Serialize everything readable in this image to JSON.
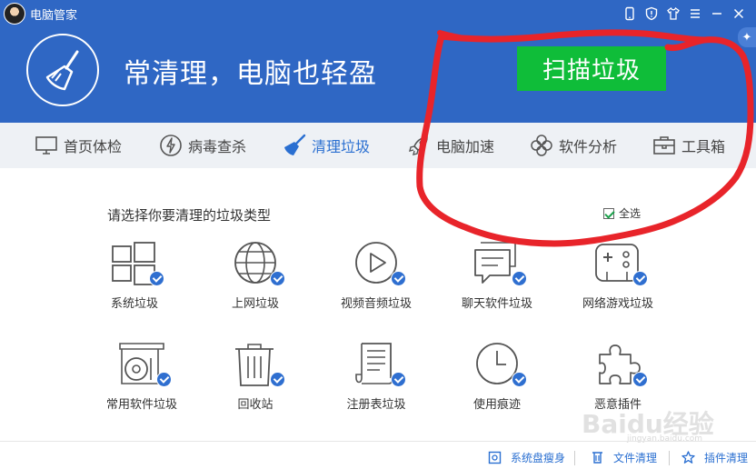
{
  "app": {
    "title": "电脑管家"
  },
  "header": {
    "slogan": "常清理，电脑也轻盈",
    "scan_label": "扫描垃圾"
  },
  "nav": {
    "items": [
      {
        "label": "首页体检",
        "icon": "monitor-icon"
      },
      {
        "label": "病毒查杀",
        "icon": "lightning-icon"
      },
      {
        "label": "清理垃圾",
        "icon": "broom-icon",
        "active": true
      },
      {
        "label": "电脑加速",
        "icon": "rocket-icon"
      },
      {
        "label": "软件分析",
        "icon": "clover-icon"
      },
      {
        "label": "工具箱",
        "icon": "toolbox-icon"
      }
    ]
  },
  "content": {
    "prompt": "请选择你要清理的垃圾类型",
    "select_all": "全选",
    "select_all_checked": true,
    "tiles": [
      {
        "label": "系统垃圾",
        "icon": "windows-icon",
        "checked": true
      },
      {
        "label": "上网垃圾",
        "icon": "globe-icon",
        "checked": true
      },
      {
        "label": "视频音频垃圾",
        "icon": "play-icon",
        "checked": true
      },
      {
        "label": "聊天软件垃圾",
        "icon": "chat-icon",
        "checked": true
      },
      {
        "label": "网络游戏垃圾",
        "icon": "gamepad-icon",
        "checked": true
      },
      {
        "label": "常用软件垃圾",
        "icon": "disc-drive-icon",
        "checked": true
      },
      {
        "label": "回收站",
        "icon": "trash-icon",
        "checked": true
      },
      {
        "label": "注册表垃圾",
        "icon": "document-icon",
        "checked": true
      },
      {
        "label": "使用痕迹",
        "icon": "clock-icon",
        "checked": true
      },
      {
        "label": "恶意插件",
        "icon": "puzzle-icon",
        "checked": true
      }
    ]
  },
  "footer": {
    "links": [
      {
        "label": "系统盘瘦身",
        "icon": "disk-slim-icon"
      },
      {
        "label": "文件清理",
        "icon": "file-clean-icon"
      },
      {
        "label": "插件清理",
        "icon": "plugin-clean-icon"
      }
    ]
  },
  "watermark": {
    "text": "Baidu经验",
    "sub": "jingyan.baidu.com"
  },
  "colors": {
    "header_bg": "#2f67c4",
    "scan_button": "#0fbd39",
    "accent": "#2a6fd1",
    "annotation": "#e8242a"
  }
}
